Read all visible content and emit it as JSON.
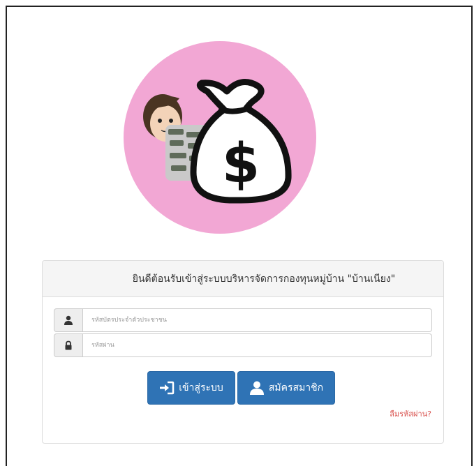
{
  "panel": {
    "title": "ยินดีต้อนรับเข้าสู่ระบบบริหารจัดการกองทุนหมู่บ้าน \"บ้านเนียง\""
  },
  "form": {
    "username_placeholder": "รหัสบัตรประจำตัวประชาชน",
    "password_placeholder": "รหัสผ่าน",
    "login_label": "เข้าสู่ระบบ",
    "register_label": "สมัครสมาชิก",
    "forgot_label": "ลืมรหัสผ่าน?"
  },
  "icons": {
    "logo": "money-bag-logo",
    "user": "user-icon",
    "lock": "lock-icon",
    "login": "sign-in-icon",
    "register": "user-icon"
  },
  "colors": {
    "logo_circle": "#f2a7d4",
    "primary_button": "#2f73b5",
    "forgot_link": "#d9534f"
  }
}
